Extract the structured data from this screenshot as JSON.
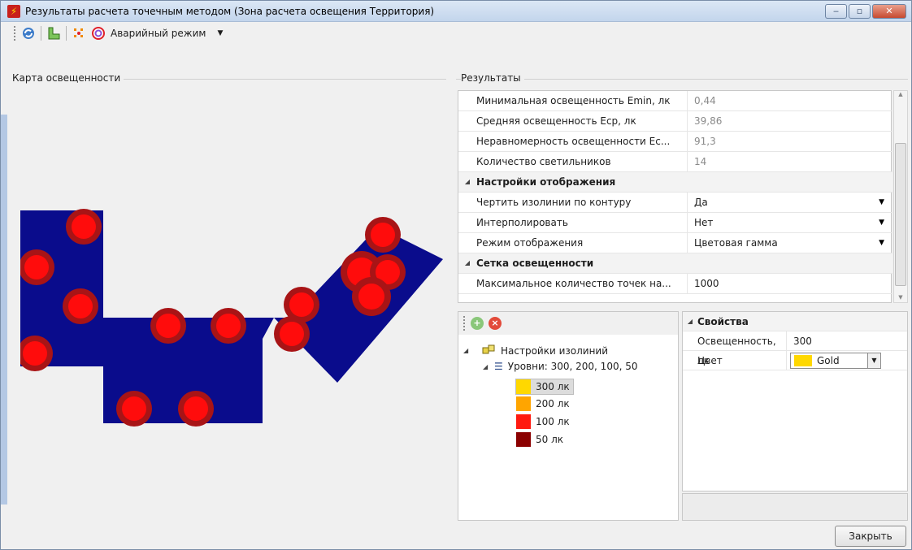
{
  "window": {
    "title": "Результаты расчета точечным методом (Зона расчета освещения Территория)",
    "buttons": {
      "minimize": "‒",
      "maximize": "▫",
      "close": "✕"
    }
  },
  "toolbar": {
    "refresh_icon": "refresh-icon",
    "layout_icon": "layout-icon",
    "points_icon": "points-icon",
    "emergency_label": "Аварийный режим",
    "dropdown_glyph": "▼"
  },
  "left_group": {
    "title": "Карта освещенности"
  },
  "results": {
    "title": "Результаты",
    "rows": [
      {
        "name": "Минимальная освещенность Emin, лк",
        "value": "0,44"
      },
      {
        "name": "Средняя освещенность Еср, лк",
        "value": "39,86"
      },
      {
        "name": "Неравномерность освещенности Ес...",
        "value": "91,3"
      },
      {
        "name": "Количество светильников",
        "value": "14"
      }
    ],
    "category_display": "Настройки отображения",
    "display_rows": [
      {
        "name": "Чертить изолинии по контуру",
        "value": "Да"
      },
      {
        "name": "Интерполировать",
        "value": "Нет"
      },
      {
        "name": "Режим отображения",
        "value": "Цветовая гамма"
      }
    ],
    "category_grid": "Сетка освещенности",
    "grid_rows": [
      {
        "name": "Максимальное количество точек на...",
        "value": "1000"
      }
    ]
  },
  "tree": {
    "root_label": "Настройки изолиний",
    "levels_label": "Уровни: 300, 200, 100, 50",
    "items": [
      {
        "label": "300 лк",
        "color": "#FFD800"
      },
      {
        "label": "200 лк",
        "color": "#FFA500"
      },
      {
        "label": "100 лк",
        "color": "#FF1A10"
      },
      {
        "label": "50 лк",
        "color": "#8B0000"
      }
    ]
  },
  "properties": {
    "title": "Свойства",
    "rows": [
      {
        "name": "Освещенность, лк",
        "value": "300"
      },
      {
        "name": "Цвет",
        "value": "Gold",
        "color": "#FFD800"
      }
    ]
  },
  "footer": {
    "close_label": "Закрыть"
  },
  "colors": {
    "map_fill": "#0a0c8c",
    "spot_outer": "#a81416",
    "spot_inner": "#ff0c0c"
  }
}
